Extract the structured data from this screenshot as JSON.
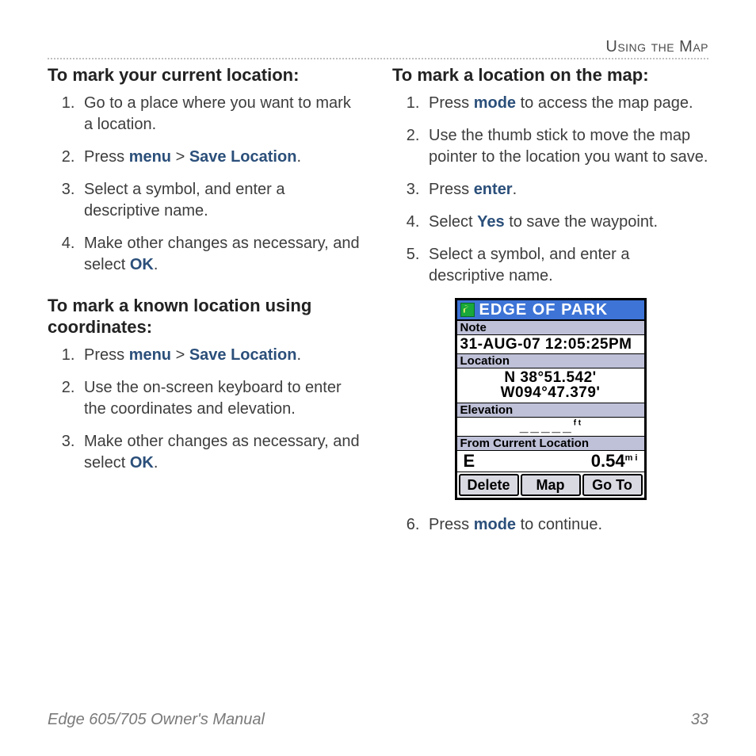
{
  "chapter": "Using the Map",
  "left": {
    "h1": "To mark your current location:",
    "s1": {
      "i1a": "Go to a place where you want to mark a location.",
      "i2a": "Press ",
      "i2b": "menu",
      "i2c": " > ",
      "i2d": "Save Location",
      "i2e": ".",
      "i3a": "Select a symbol, and enter a descriptive name.",
      "i4a": "Make other changes as necessary, and select ",
      "i4b": "OK",
      "i4c": "."
    },
    "h2": "To mark a known location using coordinates:",
    "s2": {
      "i1a": "Press ",
      "i1b": "menu",
      "i1c": " > ",
      "i1d": "Save Location",
      "i1e": ".",
      "i2a": "Use the on-screen keyboard to enter the coordinates and elevation.",
      "i3a": "Make other changes as necessary, and select ",
      "i3b": "OK",
      "i3c": "."
    }
  },
  "right": {
    "h1": "To mark a location on the map:",
    "s1": {
      "i1a": "Press ",
      "i1b": "mode",
      "i1c": " to access the map page.",
      "i2a": "Use the thumb stick to move the map pointer to the location you want to save.",
      "i3a": "Press ",
      "i3b": "enter",
      "i3c": ".",
      "i4a": "Select ",
      "i4b": "Yes",
      "i4c": " to save the waypoint.",
      "i5a": "Select a symbol, and enter a descriptive name.",
      "i6a": "Press ",
      "i6b": "mode",
      "i6c": " to continue."
    }
  },
  "device": {
    "title": "EDGE OF PARK",
    "note_lbl": "Note",
    "datetime": "31-AUG-07 12:05:25PM",
    "loc_lbl": "Location",
    "lat": "N  38°51.542'",
    "lon": "W094°47.379'",
    "elev_lbl": "Elevation",
    "elev_val": "_____",
    "elev_unit": "f t",
    "fcl_lbl": "From Current Location",
    "bearing": "E",
    "dist": "0.54",
    "dist_unit": "m i",
    "btn_delete": "Delete",
    "btn_map": "Map",
    "btn_goto": "Go To"
  },
  "footer": {
    "title": "Edge 605/705 Owner's Manual",
    "page": "33"
  }
}
